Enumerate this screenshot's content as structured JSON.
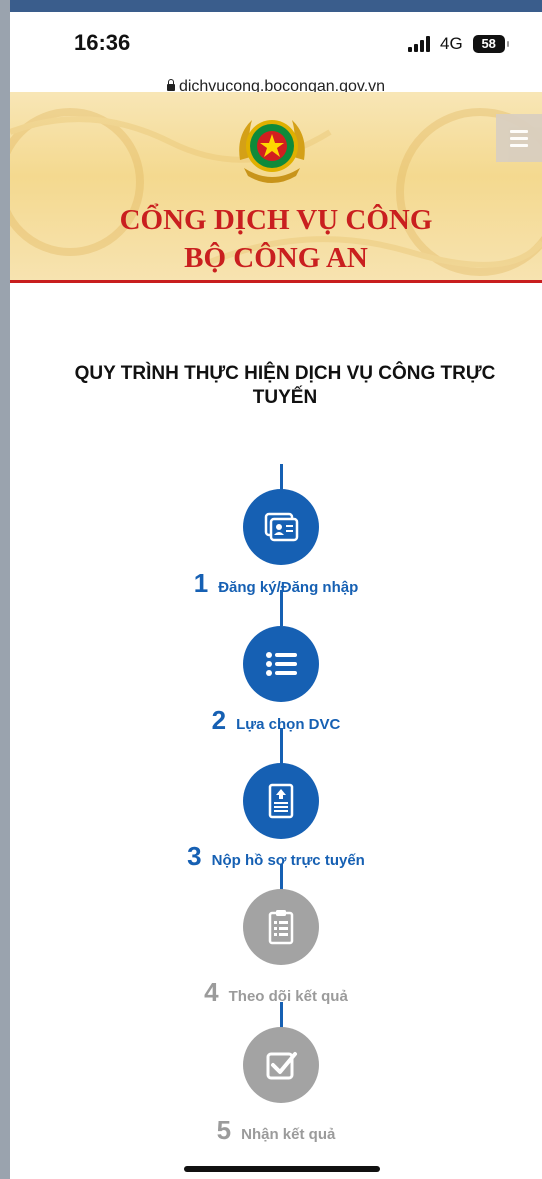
{
  "status_bar": {
    "time": "16:36",
    "network": "4G",
    "battery": "58"
  },
  "browser": {
    "url": "dichvucong.bocongan.gov.vn"
  },
  "banner": {
    "title_line1": "CỔNG DỊCH VỤ CÔNG",
    "title_line2": "BỘ CÔNG AN"
  },
  "page": {
    "heading": "QUY TRÌNH THỰC HIỆN DỊCH VỤ CÔNG TRỰC TUYẾN"
  },
  "steps": [
    {
      "number": "1",
      "label": "Đăng ký/Đăng nhập",
      "icon": "id-card-icon",
      "state": "active"
    },
    {
      "number": "2",
      "label": "Lựa chọn DVC",
      "icon": "list-icon",
      "state": "active"
    },
    {
      "number": "3",
      "label": "Nộp hồ sơ trực tuyến",
      "icon": "upload-document-icon",
      "state": "active"
    },
    {
      "number": "4",
      "label": "Theo dõi kết quả",
      "icon": "clipboard-icon",
      "state": "inactive"
    },
    {
      "number": "5",
      "label": "Nhận kết quả",
      "icon": "checkbox-icon",
      "state": "inactive"
    }
  ],
  "colors": {
    "active": "#1660b3",
    "inactive": "#9b9b9b",
    "banner_title": "#c91f1f"
  }
}
